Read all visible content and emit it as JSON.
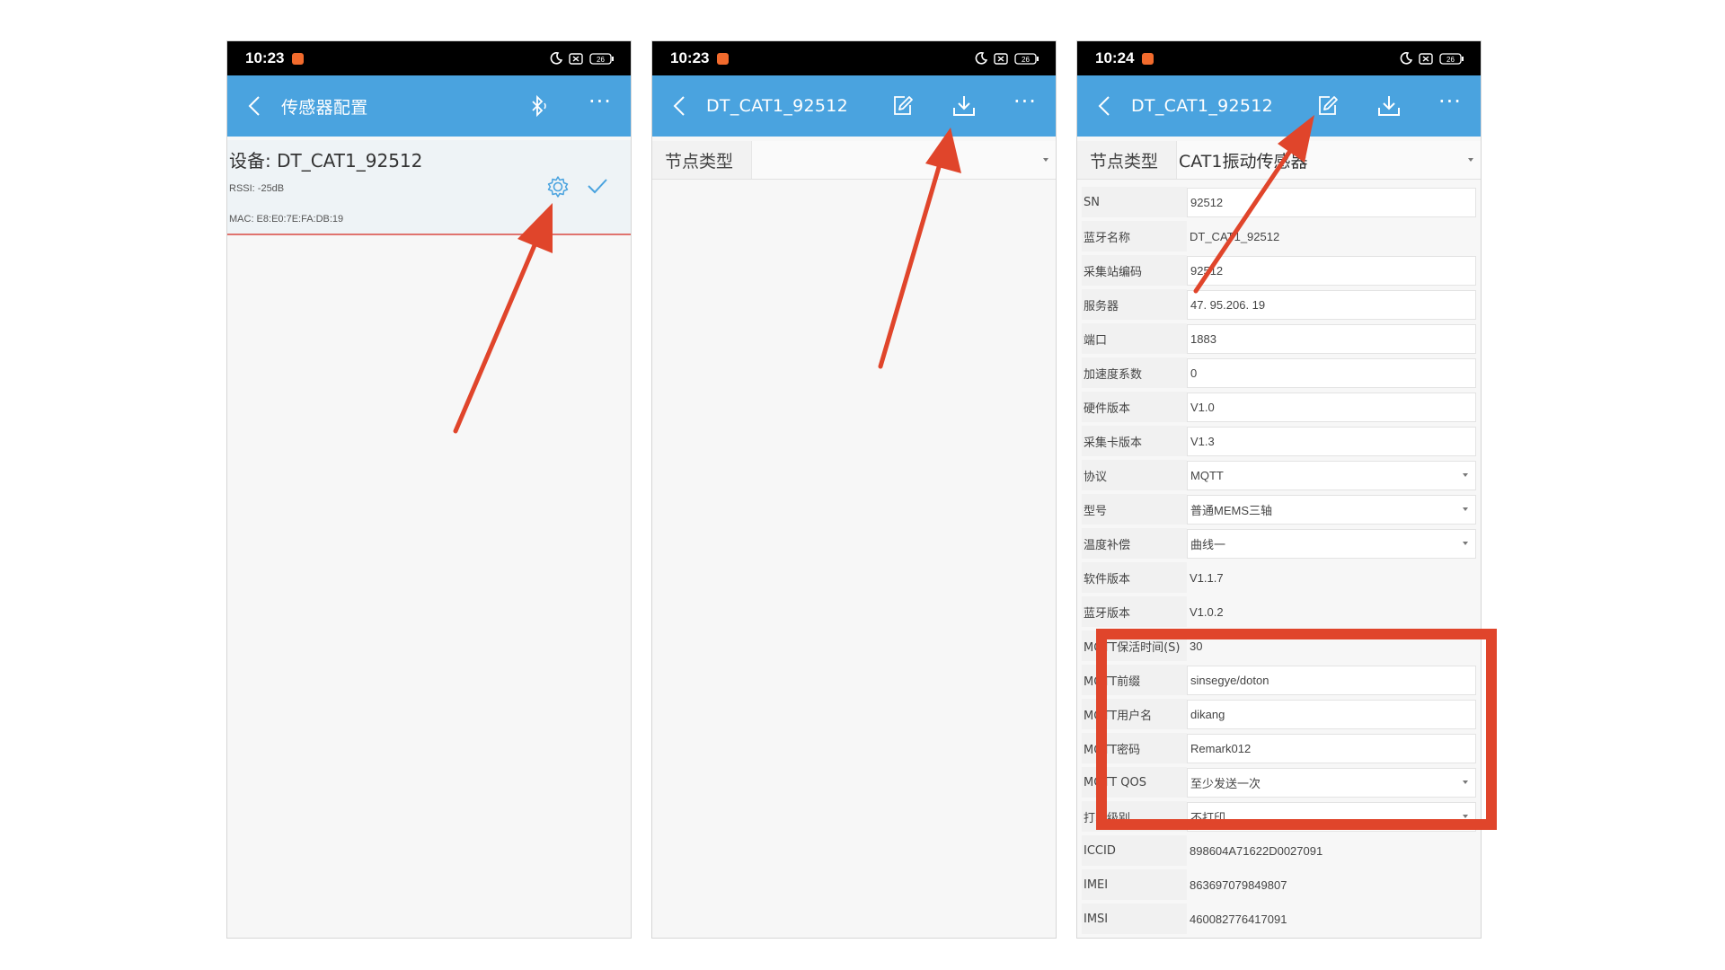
{
  "status": {
    "time_a": "10:23",
    "time_b": "10:23",
    "time_c": "10:24",
    "battery": "26"
  },
  "screen1": {
    "title": "传感器配置",
    "device_name": "设备: DT_CAT1_92512",
    "rssi": "RSSI: -25dB",
    "mac": "MAC: E8:E0:7E:FA:DB:19"
  },
  "screen2": {
    "title": "DT_CAT1_92512",
    "node_type_label": "节点类型",
    "node_type_value": ""
  },
  "screen3": {
    "title": "DT_CAT1_92512",
    "node_type_label": "节点类型",
    "node_type_value": "CAT1振动传感器",
    "rows": [
      {
        "label": "SN",
        "value": "92512",
        "kind": "input"
      },
      {
        "label": "蓝牙名称",
        "value": "DT_CAT1_92512",
        "kind": "plain"
      },
      {
        "label": "采集站编码",
        "value": "92512",
        "kind": "input"
      },
      {
        "label": "服务器",
        "value": "47. 95.206. 19",
        "kind": "input"
      },
      {
        "label": "端口",
        "value": "1883",
        "kind": "input"
      },
      {
        "label": "加速度系数",
        "value": "0",
        "kind": "input"
      },
      {
        "label": "硬件版本",
        "value": "V1.0",
        "kind": "input"
      },
      {
        "label": "采集卡版本",
        "value": "V1.3",
        "kind": "input"
      },
      {
        "label": "协议",
        "value": "MQTT",
        "kind": "select"
      },
      {
        "label": "型号",
        "value": "普通MEMS三轴",
        "kind": "select"
      },
      {
        "label": "温度补偿",
        "value": "曲线一",
        "kind": "select"
      },
      {
        "label": "软件版本",
        "value": "V1.1.7",
        "kind": "plain"
      },
      {
        "label": "蓝牙版本",
        "value": "V1.0.2",
        "kind": "plain"
      },
      {
        "label": "MQTT保活时间(S)",
        "value": "30",
        "kind": "plain"
      },
      {
        "label": "MQTT前缀",
        "value": "sinsegye/doton",
        "kind": "input"
      },
      {
        "label": "MQTT用户名",
        "value": "dikang",
        "kind": "input"
      },
      {
        "label": "MQTT密码",
        "value": "Remark012",
        "kind": "input"
      },
      {
        "label": "MQTT QOS",
        "value": "至少发送一次",
        "kind": "select"
      },
      {
        "label": "打印级别",
        "value": "不打印",
        "kind": "select"
      },
      {
        "label": "ICCID",
        "value": "898604A71622D0027091",
        "kind": "plain"
      },
      {
        "label": "IMEI",
        "value": "863697079849807",
        "kind": "plain"
      },
      {
        "label": "IMSI",
        "value": "460082776417091",
        "kind": "plain"
      }
    ]
  },
  "colors": {
    "app_bar": "#4aa3df",
    "annotation_red": "#e0452b",
    "status_bar": "#000000"
  },
  "icons": [
    "back-icon",
    "bluetooth-icon",
    "more-icon",
    "edit-icon",
    "download-icon",
    "gear-icon",
    "check-icon"
  ]
}
